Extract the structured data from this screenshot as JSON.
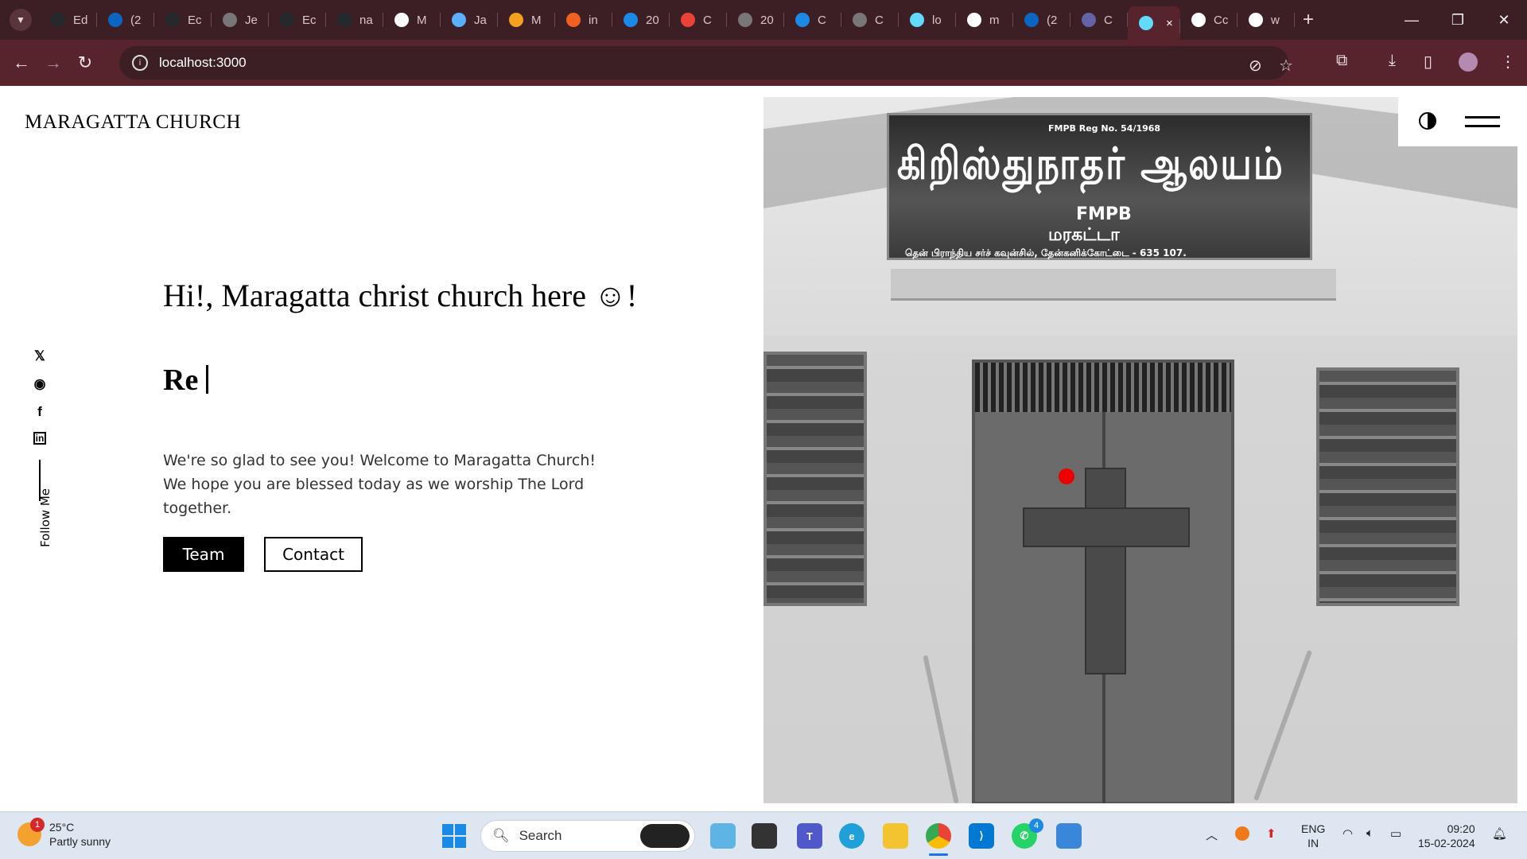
{
  "browser": {
    "tabs": [
      {
        "label": "Ed",
        "icon": "github-icon",
        "color": "#24292e"
      },
      {
        "label": "(2",
        "icon": "linkedin-icon",
        "color": "#0a66c2"
      },
      {
        "label": "Ec",
        "icon": "github-icon",
        "color": "#24292e"
      },
      {
        "label": "Je",
        "icon": "globe-icon",
        "color": "#777777"
      },
      {
        "label": "Ec",
        "icon": "github-icon",
        "color": "#24292e"
      },
      {
        "label": "na",
        "icon": "github-icon",
        "color": "#24292e"
      },
      {
        "label": "M",
        "icon": "medium-icon",
        "color": "#ffffff"
      },
      {
        "label": "Ja",
        "icon": "feather-icon",
        "color": "#5ab0ff"
      },
      {
        "label": "M",
        "icon": "rainbow-icon",
        "color": "#f4a020"
      },
      {
        "label": "in",
        "icon": "grid-icon",
        "color": "#f06020"
      },
      {
        "label": "20",
        "icon": "chat-icon",
        "color": "#1a8ae6"
      },
      {
        "label": "C",
        "icon": "gmail-icon",
        "color": "#ea4335"
      },
      {
        "label": "20",
        "icon": "globe-icon",
        "color": "#777777"
      },
      {
        "label": "C",
        "icon": "chat-icon",
        "color": "#1a8ae6"
      },
      {
        "label": "C",
        "icon": "globe-icon",
        "color": "#777777"
      },
      {
        "label": "lo",
        "icon": "react-icon",
        "color": "#61dafb"
      },
      {
        "label": "m",
        "icon": "google-icon",
        "color": "#ffffff"
      },
      {
        "label": "(2",
        "icon": "linkedin-icon",
        "color": "#0a66c2"
      },
      {
        "label": "C",
        "icon": "teams-icon",
        "color": "#6264a7"
      }
    ],
    "active_tab": {
      "icon": "react-icon",
      "close": "×"
    },
    "after_tabs": [
      {
        "label": "Cc",
        "icon": "io-icon",
        "color": "#ffffff"
      },
      {
        "label": "w",
        "icon": "google-icon",
        "color": "#ffffff"
      }
    ],
    "new_tab": "+",
    "url": "localhost:3000",
    "window_controls": {
      "minimize": "—",
      "restore": "❐",
      "close": "✕"
    }
  },
  "page": {
    "brand": "MARAGATTA CHURCH",
    "greeting": "Hi!, Maragatta christ church here ☺!",
    "typed_text": "Re",
    "welcome": "We're so glad to see you! Welcome to Maragatta Church! We hope you are blessed today as we worship The Lord together.",
    "buttons": {
      "team": "Team",
      "contact": "Contact"
    },
    "follow_label": "Follow Me",
    "socials": [
      {
        "name": "twitter-icon",
        "glyph": "🐦"
      },
      {
        "name": "github-icon",
        "glyph": "◉"
      },
      {
        "name": "facebook-icon",
        "glyph": "f"
      },
      {
        "name": "linkedin-icon",
        "glyph": "in"
      }
    ],
    "photo_sign": {
      "reg": "FMPB Reg No. 54/1968",
      "main": "கிறிஸ்துநாதர் ஆலயம்",
      "fmpb": "FMPB",
      "sub": "மரகட்டா",
      "address": "தென் பிராந்திய சர்ச் கவுன்சில், தேன்கனிக்கோட்டை - 635 107."
    }
  },
  "taskbar": {
    "weather": {
      "temp": "25°C",
      "condition": "Partly sunny",
      "badge": "1"
    },
    "search_label": "Search",
    "whatsapp_badge": "4",
    "language": {
      "line1": "ENG",
      "line2": "IN"
    },
    "clock": {
      "time": "09:20",
      "date": "15-02-2024"
    }
  }
}
